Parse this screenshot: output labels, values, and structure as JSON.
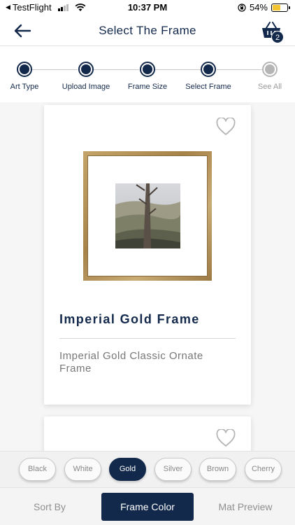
{
  "status_bar": {
    "back_app": "TestFlight",
    "time": "10:37 PM",
    "battery": "54%",
    "battery_level": 0.54
  },
  "header": {
    "title": "Select The Frame",
    "cart_count": "2"
  },
  "stepper": {
    "steps": [
      {
        "label": "Art Type",
        "state": "done"
      },
      {
        "label": "Upload Image",
        "state": "done"
      },
      {
        "label": "Frame Size",
        "state": "done"
      },
      {
        "label": "Select Frame",
        "state": "current"
      },
      {
        "label": "See All",
        "state": "inactive"
      }
    ]
  },
  "frames": [
    {
      "title": "Imperial Gold Frame",
      "description": "Imperial Gold Classic Ornate Frame"
    }
  ],
  "color_filters": {
    "options": [
      "Black",
      "White",
      "Gold",
      "Silver",
      "Brown",
      "Cherry"
    ],
    "selected": "Gold"
  },
  "bottom_tabs": {
    "tabs": [
      "Sort By",
      "Frame Color",
      "Mat Preview"
    ],
    "selected": "Frame Color"
  },
  "colors": {
    "primary": "#13294b",
    "frame_gold": "#b8965a",
    "inactive": "#b5b5b5"
  }
}
